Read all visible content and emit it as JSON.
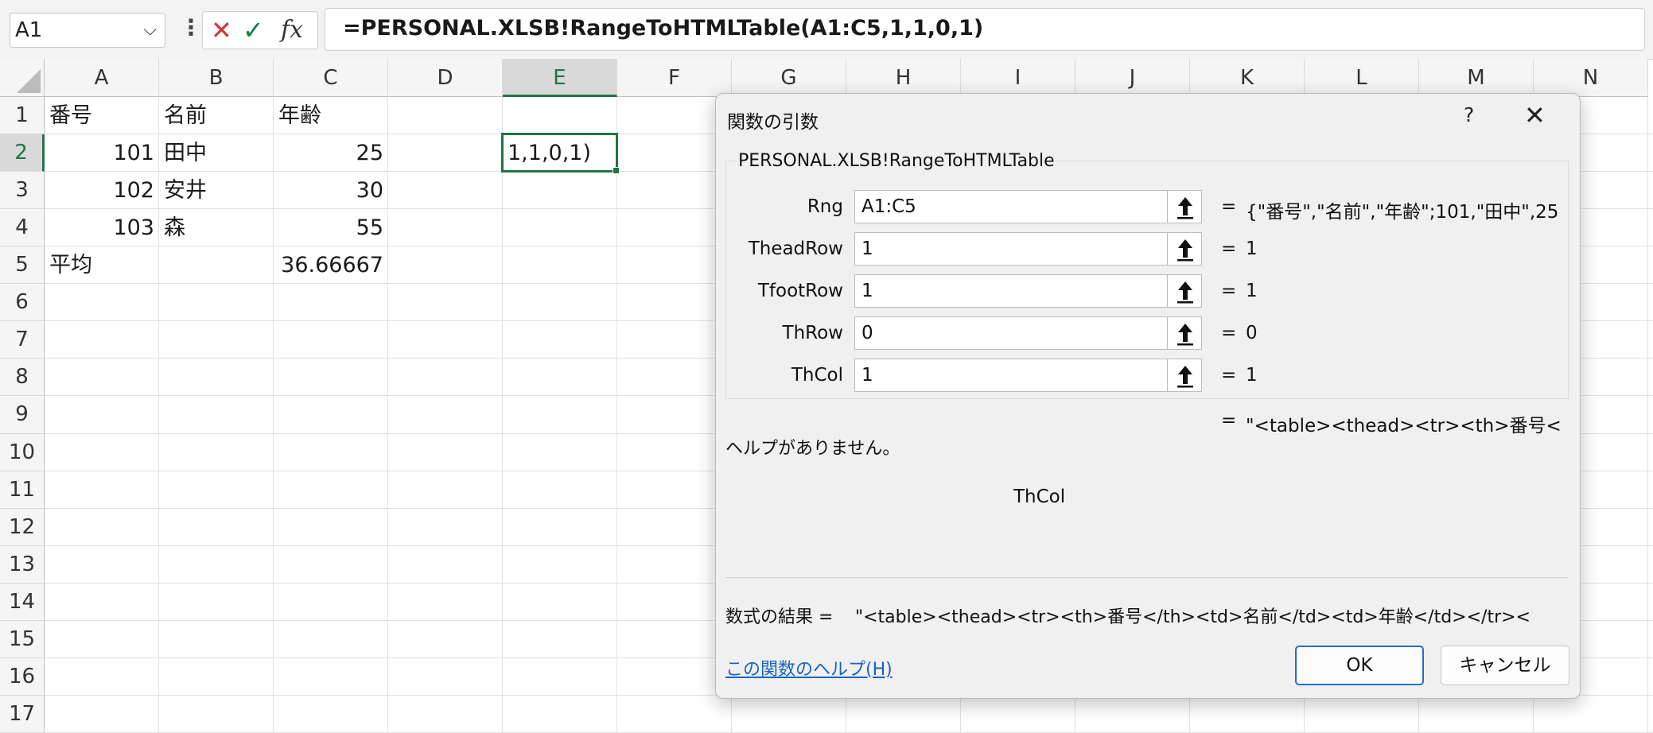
{
  "formula_bar": {
    "name_box": "A1",
    "cancel_glyph": "✕",
    "enter_glyph": "✓",
    "fx_label": "fx",
    "formula": "=PERSONAL.XLSB!RangeToHTMLTable(A1:C5,1,1,0,1)"
  },
  "sheet": {
    "columns": [
      "A",
      "B",
      "C",
      "D",
      "E",
      "F",
      "G",
      "H",
      "I",
      "J",
      "K",
      "L",
      "M",
      "N"
    ],
    "rows": [
      "1",
      "2",
      "3",
      "4",
      "5",
      "6",
      "7",
      "8",
      "9",
      "10",
      "11",
      "12",
      "13",
      "14",
      "15",
      "16",
      "17"
    ],
    "selected_column": "E",
    "selected_row": "2",
    "cells": {
      "A1": "番号",
      "B1": "名前",
      "C1": "年齢",
      "A2": "101",
      "B2": "田中",
      "C2": "25",
      "E2": "1,1,0,1)",
      "A3": "102",
      "B3": "安井",
      "C3": "30",
      "A4": "103",
      "B4": "森",
      "C4": "55",
      "A5": "平均",
      "C5": "36.66667"
    }
  },
  "dialog": {
    "title": "関数の引数",
    "help_glyph": "?",
    "close_glyph": "✕",
    "function_name": "PERSONAL.XLSB!RangeToHTMLTable",
    "args": [
      {
        "label": "Rng",
        "value": "A1:C5",
        "result": "{\"番号\",\"名前\",\"年齢\";101,\"田中\",25"
      },
      {
        "label": "TheadRow",
        "value": "1",
        "result": "1"
      },
      {
        "label": "TfootRow",
        "value": "1",
        "result": "1"
      },
      {
        "label": "ThRow",
        "value": "0",
        "result": "0"
      },
      {
        "label": "ThCol",
        "value": "1",
        "result": "1"
      }
    ],
    "eq": "=",
    "function_result": "\"<table><thead><tr><th>番号<",
    "help_text": "ヘルプがありません。",
    "current_arg": "ThCol",
    "formula_result_label": "数式の結果 =",
    "formula_result": "\"<table><thead><tr><th>番号</th><td>名前</td><td>年齢</td></tr><",
    "help_link": "この関数のヘルプ(H)",
    "ok": "OK",
    "cancel": "キャンセル"
  },
  "colors": {
    "accent_green": "#217346",
    "link_blue": "#1565c0",
    "cancel_red": "#d13438",
    "enter_green": "#107c41"
  }
}
